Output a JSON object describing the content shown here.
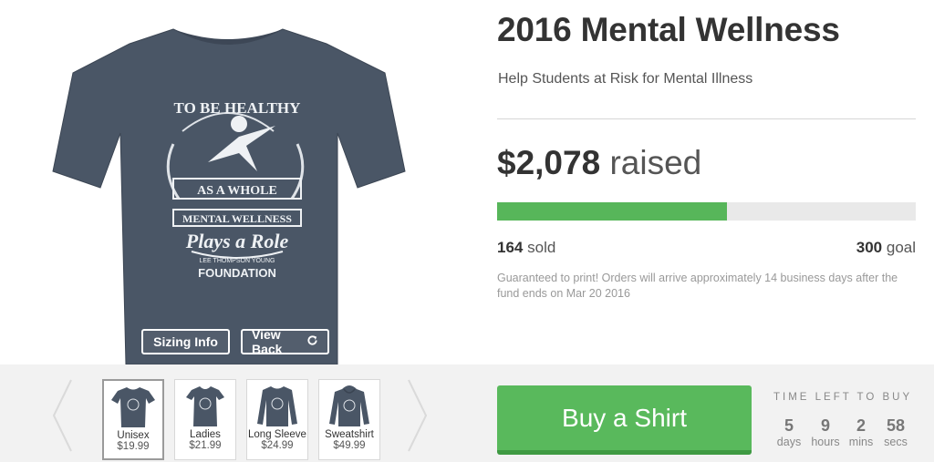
{
  "product": {
    "shirt_color": "#4a5666",
    "print_text": {
      "line1": "TO BE HEALTHY",
      "line2": "AS A WHOLE",
      "line3": "MENTAL WELLNESS",
      "line4": "Plays a Role",
      "line5": "LEE THOMPSON YOUNG",
      "line6": "FOUNDATION"
    },
    "sizing_label": "Sizing Info",
    "view_back_label": "View Back",
    "view_back_icon": "refresh-icon"
  },
  "styles": [
    {
      "name": "Unisex",
      "price": "$19.99",
      "selected": true
    },
    {
      "name": "Ladies",
      "price": "$21.99",
      "selected": false
    },
    {
      "name": "Long Sleeve",
      "price": "$24.99",
      "selected": false
    },
    {
      "name": "Sweatshirt",
      "price": "$49.99",
      "selected": false
    }
  ],
  "campaign": {
    "title": "2016 Mental Wellness",
    "subtitle": "Help Students at Risk for Mental Illness",
    "raised_amount": "$2,078",
    "raised_word": "raised",
    "sold_count": "164",
    "sold_label": "sold",
    "goal_count": "300",
    "goal_label": "goal",
    "progress_percent": 55,
    "note": "Guaranteed to print! Orders will arrive approximately 14 business days after the fund ends on Mar 20 2016",
    "buy_label": "Buy a Shirt",
    "accent_color": "#59b95c"
  },
  "timer": {
    "label": "TIME LEFT TO BUY",
    "days": "5",
    "days_label": "days",
    "hours": "9",
    "hours_label": "hours",
    "mins": "2",
    "mins_label": "mins",
    "secs": "58",
    "secs_label": "secs"
  }
}
